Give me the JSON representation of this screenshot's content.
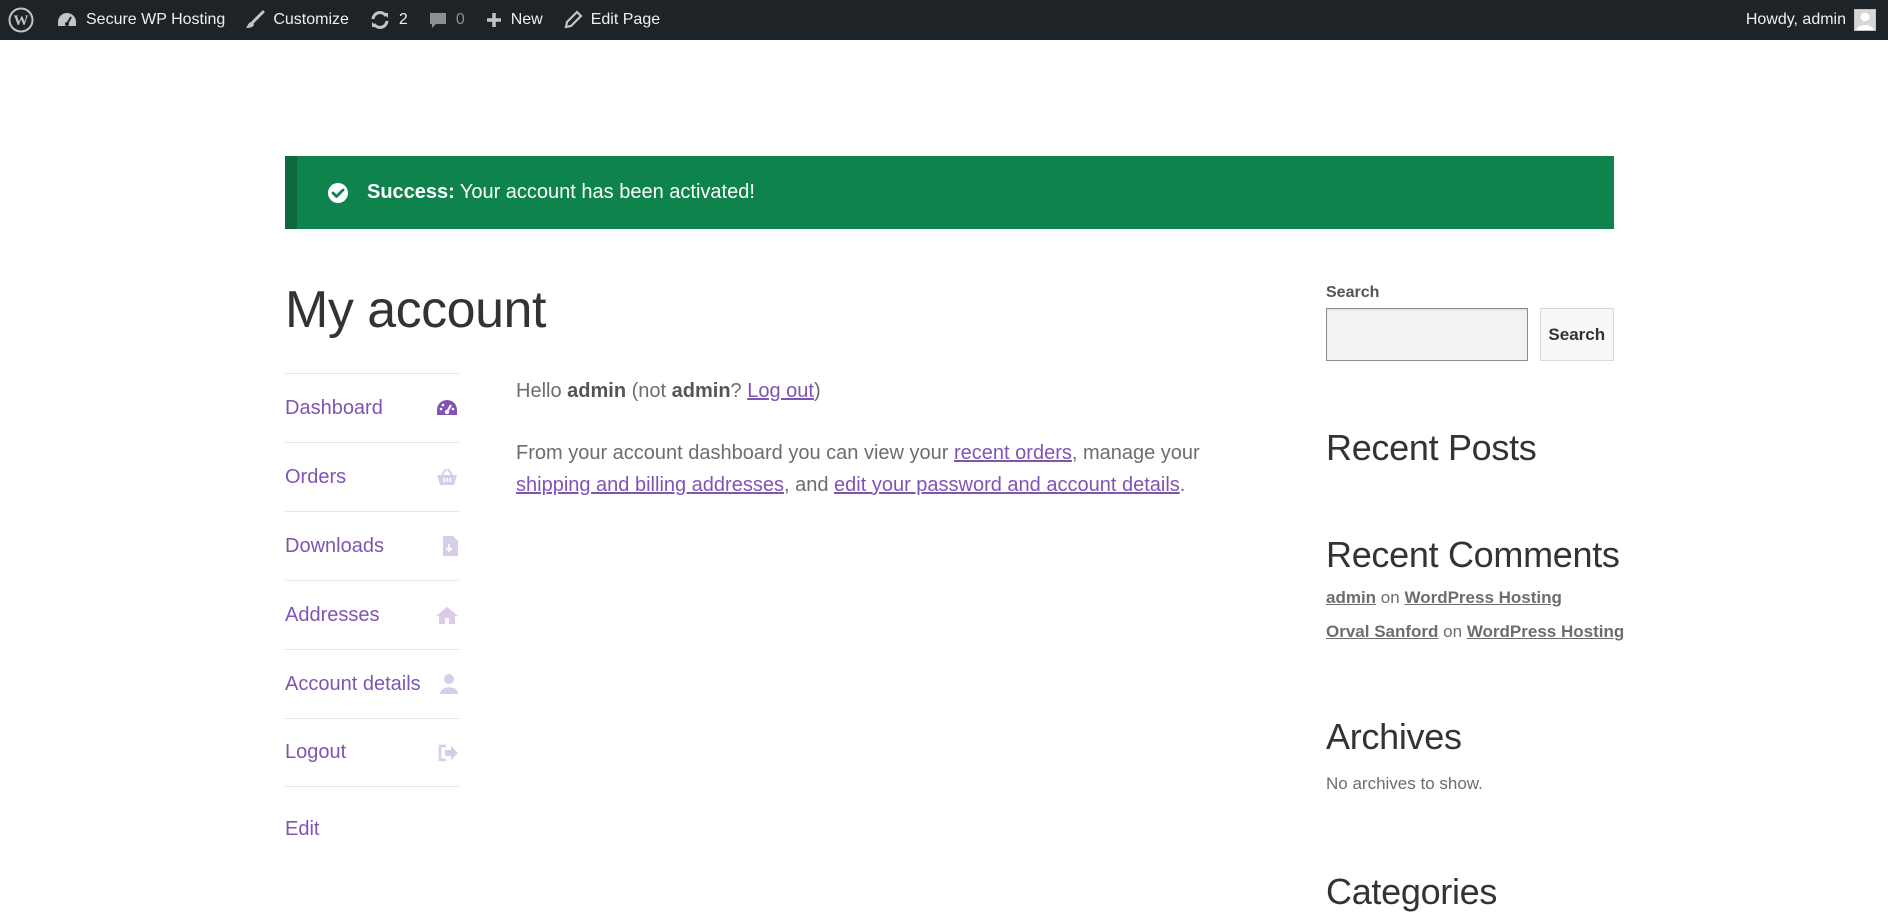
{
  "admin_bar": {
    "site_name": "Secure WP Hosting",
    "customize": "Customize",
    "updates_count": "2",
    "comments_count": "0",
    "new_label": "New",
    "edit_page": "Edit Page",
    "howdy": "Howdy, admin",
    "bg_color": "#1d2327"
  },
  "notice": {
    "strong": "Success:",
    "message": "Your account has been activated!",
    "color": "#0f834d"
  },
  "page": {
    "title": "My account"
  },
  "account_nav": {
    "items": [
      {
        "label": "Dashboard",
        "icon": "dashboard-icon"
      },
      {
        "label": "Orders",
        "icon": "basket-icon"
      },
      {
        "label": "Downloads",
        "icon": "file-download-icon"
      },
      {
        "label": "Addresses",
        "icon": "home-icon"
      },
      {
        "label": "Account details",
        "icon": "user-icon"
      },
      {
        "label": "Logout",
        "icon": "sign-out-icon"
      }
    ],
    "accent": "#7f54b3"
  },
  "edit_link": "Edit",
  "content": {
    "hello": "Hello",
    "user": "admin",
    "not_prefix": "(not",
    "not_user": "admin",
    "question": "?",
    "logout": "Log out",
    "close_paren": ")",
    "dash_intro": "From your account dashboard you can view your",
    "recent_orders": "recent orders",
    "manage_your": ", manage your",
    "addresses_link": "shipping and billing addresses",
    "and": ", and",
    "edit_link": "edit your password and account details",
    "period": "."
  },
  "sidebar": {
    "search_label": "Search",
    "search_button": "Search",
    "search_value": "",
    "recent_posts_title": "Recent Posts",
    "recent_comments_title": "Recent Comments",
    "comments": [
      {
        "author": "admin",
        "on": "on",
        "post": "WordPress Hosting"
      },
      {
        "author": "Orval Sanford",
        "on": "on",
        "post": "WordPress Hosting"
      }
    ],
    "archives_title": "Archives",
    "archives_empty": "No archives to show.",
    "categories_title": "Categories"
  }
}
